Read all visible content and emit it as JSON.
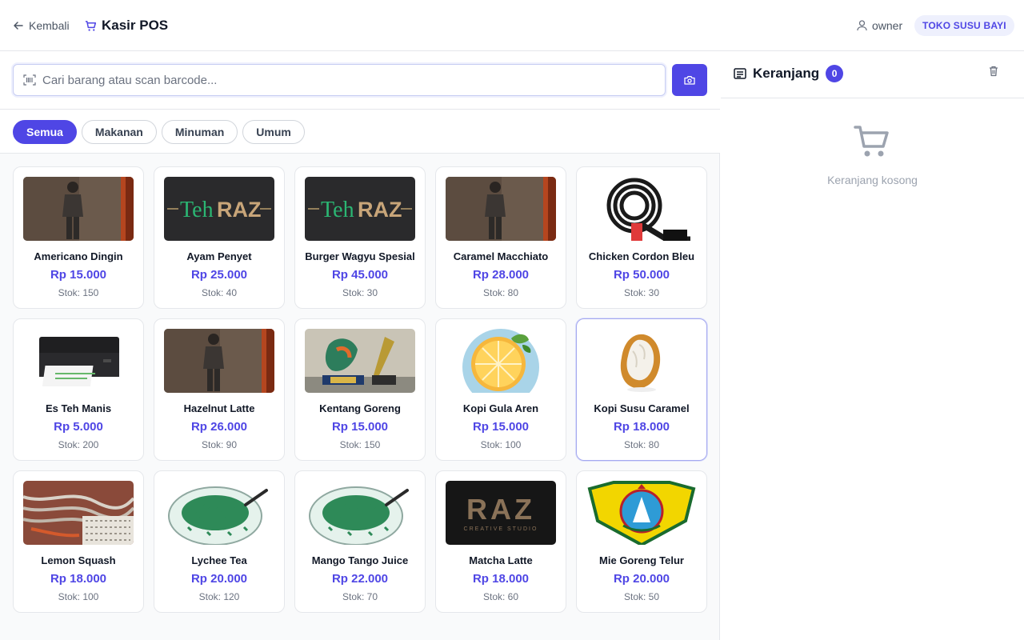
{
  "header": {
    "back_label": "Kembali",
    "title": "Kasir POS",
    "user": "owner",
    "store": "TOKO SUSU BAYI"
  },
  "search": {
    "placeholder": "Cari barang atau scan barcode...",
    "value": ""
  },
  "categories": [
    "Semua",
    "Makanan",
    "Minuman",
    "Umum"
  ],
  "active_category": "Semua",
  "products": [
    {
      "name": "Americano Dingin",
      "price": "Rp 15.000",
      "stock": "Stok: 150",
      "image": "person-photo"
    },
    {
      "name": "Ayam Penyet",
      "price": "Rp 25.000",
      "stock": "Stok: 40",
      "image": "tehraz-logo"
    },
    {
      "name": "Burger Wagyu Spesial",
      "price": "Rp 45.000",
      "stock": "Stok: 30",
      "image": "tehraz-logo"
    },
    {
      "name": "Caramel Macchiato",
      "price": "Rp 28.000",
      "stock": "Stok: 80",
      "image": "person-photo"
    },
    {
      "name": "Chicken Cordon Bleu",
      "price": "Rp 50.000",
      "stock": "Stok: 30",
      "image": "cable-photo"
    },
    {
      "name": "Es Teh Manis",
      "price": "Rp 5.000",
      "stock": "Stok: 200",
      "image": "printer-photo"
    },
    {
      "name": "Hazelnut Latte",
      "price": "Rp 26.000",
      "stock": "Stok: 90",
      "image": "person-photo"
    },
    {
      "name": "Kentang Goreng",
      "price": "Rp 15.000",
      "stock": "Stok: 150",
      "image": "trophy-photo"
    },
    {
      "name": "Kopi Gula Aren",
      "price": "Rp 15.000",
      "stock": "Stok: 100",
      "image": "lemon-illustration"
    },
    {
      "name": "Kopi Susu Caramel",
      "price": "Rp 18.000",
      "stock": "Stok: 80",
      "image": "cacao-illustration"
    },
    {
      "name": "Lemon Squash",
      "price": "Rp 18.000",
      "stock": "Stok: 100",
      "image": "cables-photo"
    },
    {
      "name": "Lychee Tea",
      "price": "Rp 20.000",
      "stock": "Stok: 120",
      "image": "cendol-illustration"
    },
    {
      "name": "Mango Tango Juice",
      "price": "Rp 22.000",
      "stock": "Stok: 70",
      "image": "cendol-illustration"
    },
    {
      "name": "Matcha Latte",
      "price": "Rp 18.000",
      "stock": "Stok: 60",
      "image": "raz-logo"
    },
    {
      "name": "Mie Goreng Telur",
      "price": "Rp 20.000",
      "stock": "Stok: 50",
      "image": "emblem-logo"
    }
  ],
  "selected_product": "Kopi Susu Caramel",
  "logos": {
    "tehraz": {
      "part1": "Teh",
      "part2": "RAZ"
    },
    "raz": {
      "title": "RAZ",
      "subtitle": "CREATIVE STUDIO"
    }
  },
  "cart": {
    "title": "Keranjang",
    "count": "0",
    "empty_text": "Keranjang kosong"
  },
  "colors": {
    "accent": "#4f46e5",
    "accent_soft": "#eef0fd",
    "muted": "#6b7280"
  },
  "icons": {
    "back": "arrow-left-icon",
    "title": "cart-icon",
    "user": "user-icon",
    "search": "barcode-icon",
    "camera": "camera-icon",
    "cart_header": "receipt-icon",
    "clear": "trash-icon",
    "empty": "shopping-cart-icon"
  }
}
